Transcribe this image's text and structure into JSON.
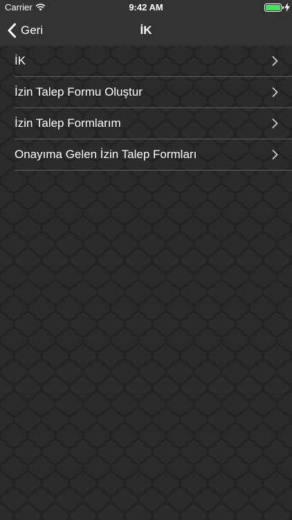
{
  "status_bar": {
    "carrier": "Carrier",
    "time": "9:42 AM",
    "battery_color": "#4cd964"
  },
  "nav_bar": {
    "back_label": "Geri",
    "back_icon": "chevron-left-icon",
    "title": "İK"
  },
  "menu": {
    "items": [
      {
        "label": "İK"
      },
      {
        "label": "İzin Talep Formu Oluştur"
      },
      {
        "label": "İzin Talep Formlarım"
      },
      {
        "label": "Onayıma Gelen İzin Talep Formları"
      }
    ],
    "chevron_icon": "chevron-right-icon"
  },
  "colors": {
    "background": "#2b2b2b",
    "bars": "#333333",
    "separator": "#5c5c5c",
    "text": "#ffffff"
  }
}
